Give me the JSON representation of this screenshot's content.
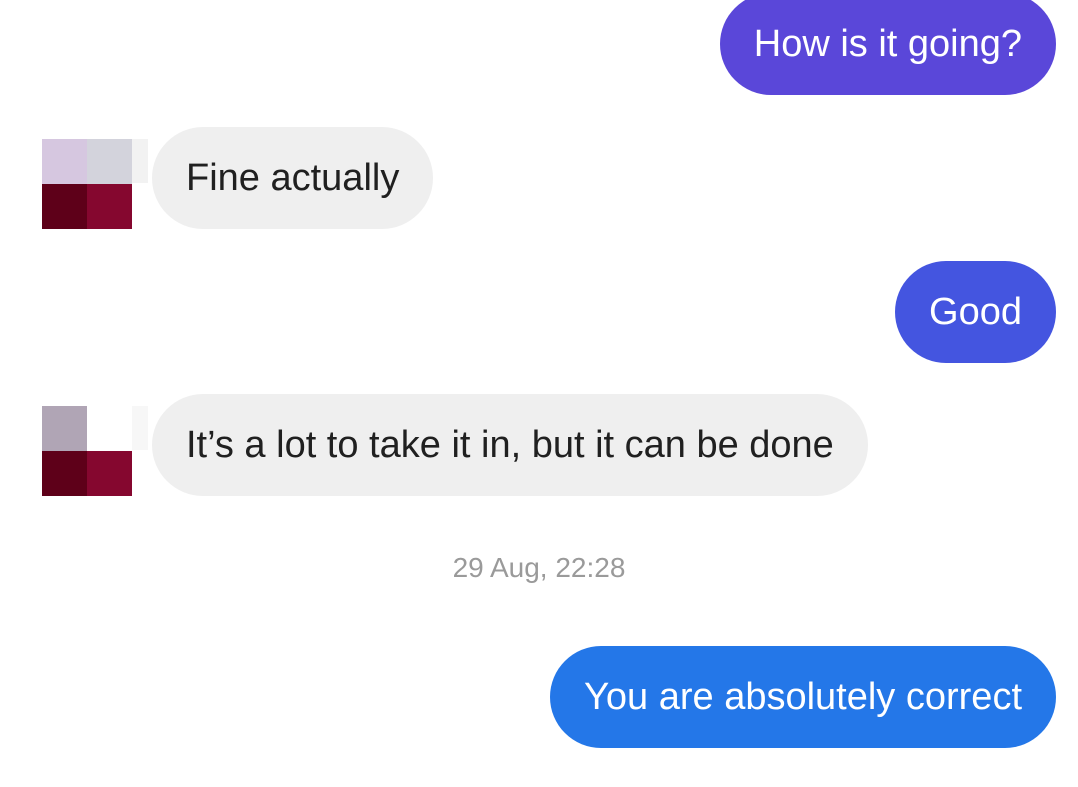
{
  "messages": [
    {
      "direction": "outgoing",
      "text": "How is it going?",
      "color": "#5a47d9"
    },
    {
      "direction": "incoming",
      "text": "Fine actually"
    },
    {
      "direction": "outgoing",
      "text": "Good",
      "color": "#4455e0"
    },
    {
      "direction": "incoming",
      "text": "It’s a lot to take it in, but it can be done"
    },
    {
      "direction": "outgoing",
      "text": "You are absolutely correct",
      "color": "#2477e8"
    }
  ],
  "timestamp": "29 Aug, 22:28",
  "colors": {
    "incoming_bubble": "#efefef",
    "incoming_text": "#202020",
    "timestamp_text": "#9a9a9a",
    "avatar_1": [
      "#d6c7e0",
      "#d3d3dc",
      "#5e0019",
      "#85072f"
    ],
    "avatar_2": [
      "#b0a5b5",
      "#ffffff",
      "#5e0019",
      "#85072f"
    ]
  }
}
